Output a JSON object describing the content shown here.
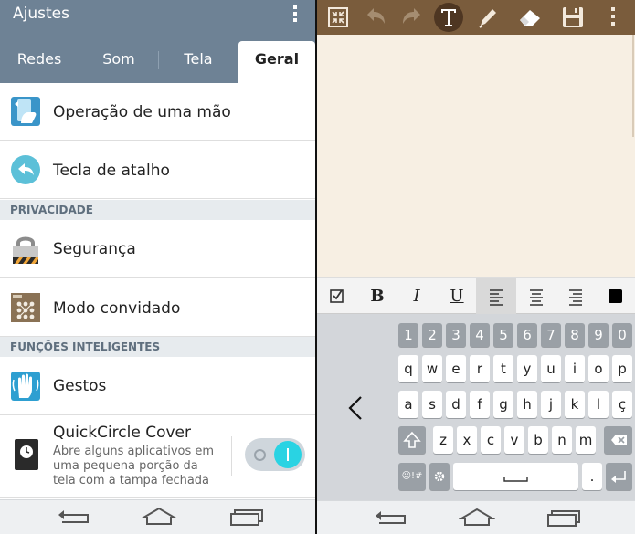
{
  "settings": {
    "title": "Ajustes",
    "tabs": [
      {
        "label": "Redes",
        "active": false
      },
      {
        "label": "Som",
        "active": false
      },
      {
        "label": "Tela",
        "active": false
      },
      {
        "label": "Geral",
        "active": true
      }
    ],
    "items": [
      {
        "label": "Operação de uma mão",
        "icon": "one-hand-icon"
      },
      {
        "label": "Tecla de atalho",
        "icon": "shortcut-key-icon"
      }
    ],
    "sections": [
      {
        "title": "PRIVACIDADE",
        "items": [
          {
            "label": "Segurança",
            "icon": "padlock-icon"
          },
          {
            "label": "Modo convidado",
            "icon": "guest-mode-icon"
          }
        ]
      },
      {
        "title": "FUNÇÕES INTELIGENTES",
        "items": [
          {
            "label": "Gestos",
            "icon": "hand-gesture-icon"
          },
          {
            "label": "QuickCircle Cover",
            "icon": "quickcircle-icon",
            "description": "Abre alguns aplicativos em uma pequena porção da tela com a tampa fechada",
            "toggle_on": true
          }
        ]
      }
    ]
  },
  "note": {
    "toolbar": [
      "collapse-icon",
      "undo-icon",
      "redo-icon",
      "text-tool-icon",
      "pen-icon",
      "eraser-icon",
      "save-icon",
      "overflow-menu-icon"
    ],
    "selected_tool": "text-tool-icon",
    "format": {
      "bold": "B",
      "italic": "I",
      "underline": "U",
      "selected_align": "left"
    },
    "keyboard": {
      "numbers": [
        "1",
        "2",
        "3",
        "4",
        "5",
        "6",
        "7",
        "8",
        "9",
        "0"
      ],
      "row1": [
        "q",
        "w",
        "e",
        "r",
        "t",
        "y",
        "u",
        "i",
        "o",
        "p"
      ],
      "row2": [
        "a",
        "s",
        "d",
        "f",
        "g",
        "h",
        "j",
        "k",
        "l",
        "ç"
      ],
      "row3": [
        "z",
        "x",
        "c",
        "v",
        "b",
        "n",
        "m"
      ],
      "symbols_key": "☺!#",
      "period_key": "."
    }
  },
  "colors": {
    "settings_header": "#6e8295",
    "note_toolbar": "#7a5c3c",
    "note_canvas": "#f7efe3",
    "toggle_accent": "#29d3e3"
  }
}
